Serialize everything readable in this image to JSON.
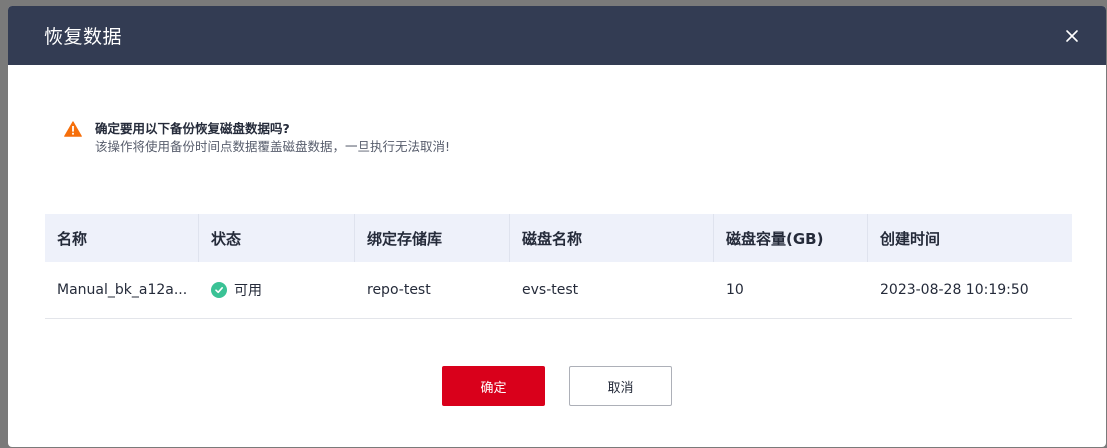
{
  "dialog": {
    "title": "恢复数据",
    "close_icon": "close-icon"
  },
  "warning": {
    "icon": "warning-icon",
    "color": "#f66f0b",
    "title": "确定要用以下备份恢复磁盘数据吗?",
    "description": "该操作将使用备份时间点数据覆盖磁盘数据，一旦执行无法取消!"
  },
  "table": {
    "headers": [
      "名称",
      "状态",
      "绑定存储库",
      "磁盘名称",
      "磁盘容量(GB)",
      "创建时间"
    ],
    "rows": [
      {
        "name": "Manual_bk_a12a...",
        "status": "可用",
        "status_icon": "check-circle-icon",
        "status_color": "#3ac295",
        "repository": "repo-test",
        "disk_name": "evs-test",
        "disk_capacity": "10",
        "created_time": "2023-08-28 10:19:50"
      }
    ]
  },
  "buttons": {
    "confirm": "确定",
    "cancel": "取消",
    "confirm_color": "#d9001b"
  }
}
